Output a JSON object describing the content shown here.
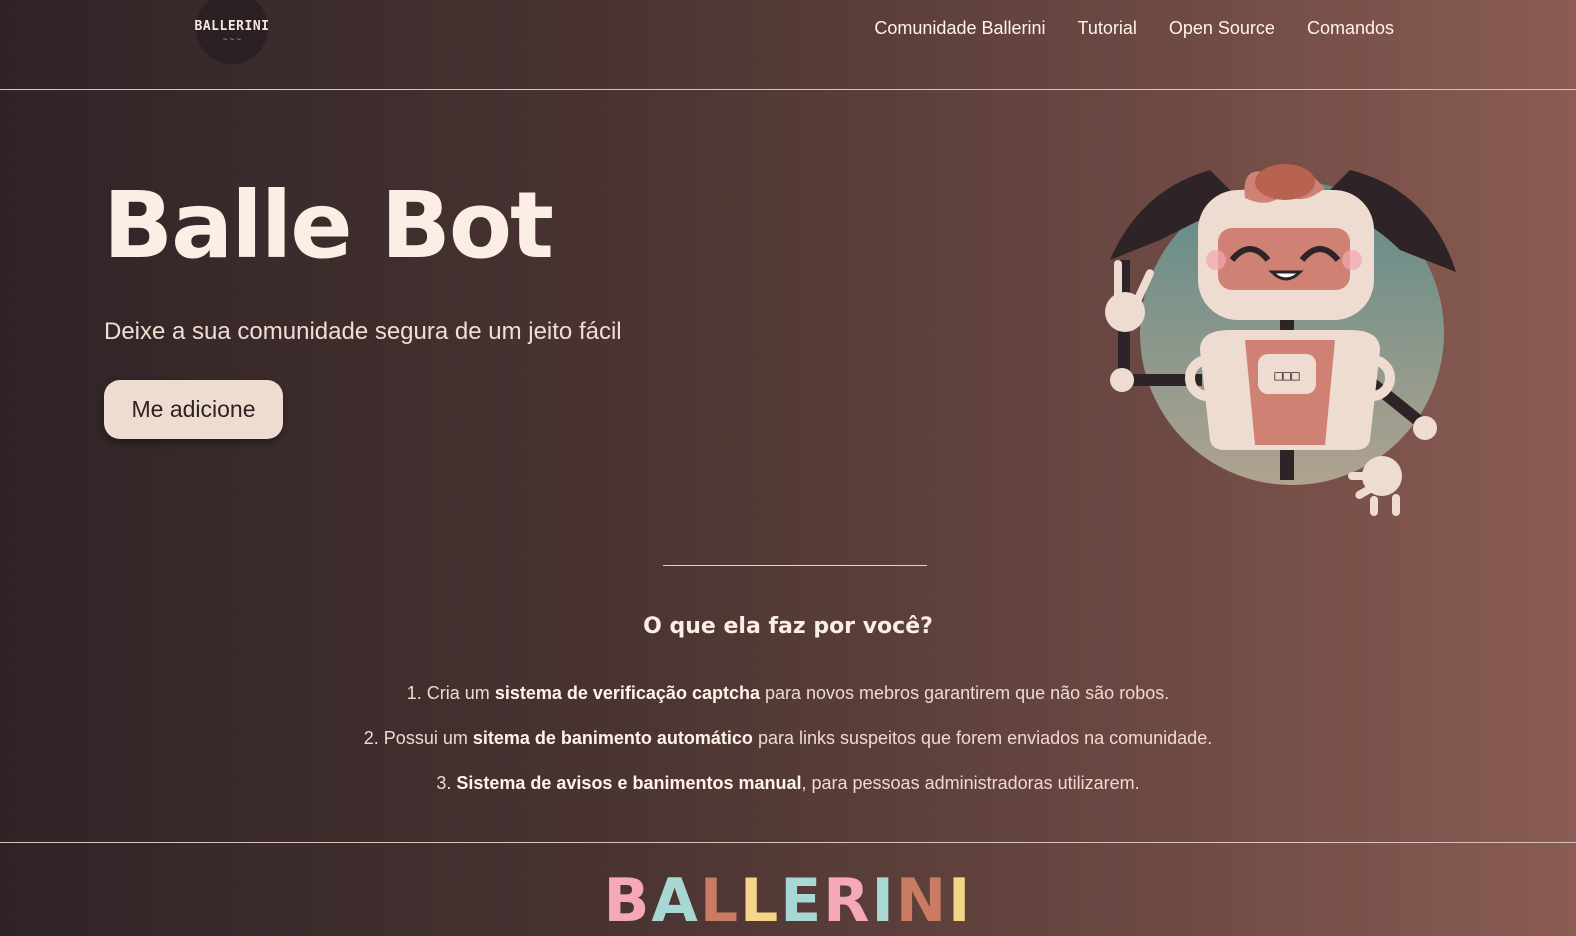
{
  "header": {
    "logo_text": "BALLERINI",
    "nav": [
      {
        "label": "Comunidade Ballerini"
      },
      {
        "label": "Tutorial"
      },
      {
        "label": "Open Source"
      },
      {
        "label": "Comandos"
      }
    ]
  },
  "hero": {
    "title": "Balle Bot",
    "subtitle": "Deixe a sua comunidade segura de um jeito fácil",
    "cta_label": "Me adicione",
    "robot_screen_text": "□□□"
  },
  "features": {
    "title": "O que ela faz por você?",
    "items": [
      {
        "num": "1.",
        "pre": "Cria um",
        "bold": "sistema de verificação captcha",
        "post": "para novos mebros garantirem que não são robos."
      },
      {
        "num": "2.",
        "pre": "Possui um",
        "bold": "sitema de banimento automático",
        "post": "para links suspeitos que forem enviados na comunidade."
      },
      {
        "num": "3.",
        "pre": "",
        "bold": "Sistema de avisos e banimentos manual",
        "post": ", para pessoas administradoras utilizarem."
      }
    ]
  },
  "footer": {
    "logo_letters": [
      "B",
      "A",
      "L",
      "L",
      "E",
      "R",
      "I",
      "N",
      "I"
    ],
    "logo_colors": [
      "#f5a9b8",
      "#a8d8d3",
      "#c97c63",
      "#f4d58a",
      "#a8d8d3",
      "#f5a9b8",
      "#a8d8d3",
      "#c97c63",
      "#f4d58a"
    ]
  }
}
